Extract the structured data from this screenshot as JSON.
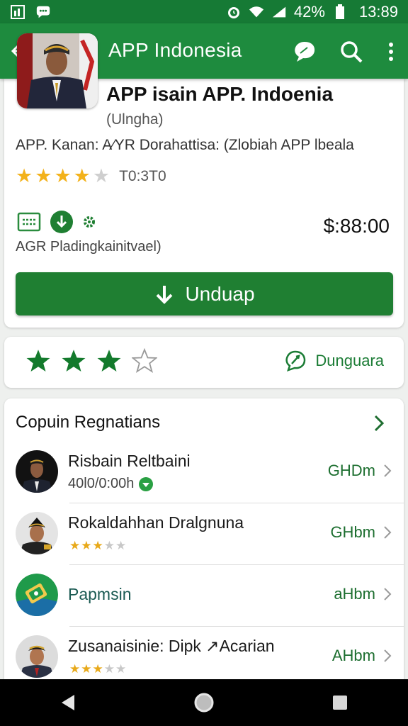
{
  "status_bar": {
    "battery": "42%",
    "time": "13:89"
  },
  "app_bar": {
    "title": "APP Indonesia"
  },
  "app": {
    "name": "APP isain APP. Indoenia",
    "subtitle": "(Ulngha)",
    "description": "APP. Kanan: A∕YR Dorahattisa: (Zlobiah APP lbeala",
    "rating": 4,
    "rating_max": 5,
    "rating_count": "T0:3T0",
    "price": "$:88:00",
    "meta_label": "AGR Pladingkainitvael)",
    "install_label": "Unduap"
  },
  "rate": {
    "stars_filled": 3,
    "stars_total": 4,
    "feedback_label": "Dunguara"
  },
  "list": {
    "title": "Copuin Regnatians",
    "items": [
      {
        "title": "Risbain Reltbaini",
        "sub": "40l0/0:00h",
        "size": "GHDm",
        "stars": null
      },
      {
        "title": "Rokaldahhan Dralgnuna",
        "sub": null,
        "size": "GHbm",
        "stars": 3
      },
      {
        "title": "Papmsin",
        "sub": null,
        "size": "aHbm",
        "stars": null
      },
      {
        "title": "Zusanaisinie: Dipk ↗Acarian",
        "sub": null,
        "size": "AHbm",
        "stars": 3
      }
    ]
  },
  "colors": {
    "primary": "#1e8b3e",
    "status": "#167a35",
    "button": "#1f7f32",
    "star": "#f3b21b"
  }
}
